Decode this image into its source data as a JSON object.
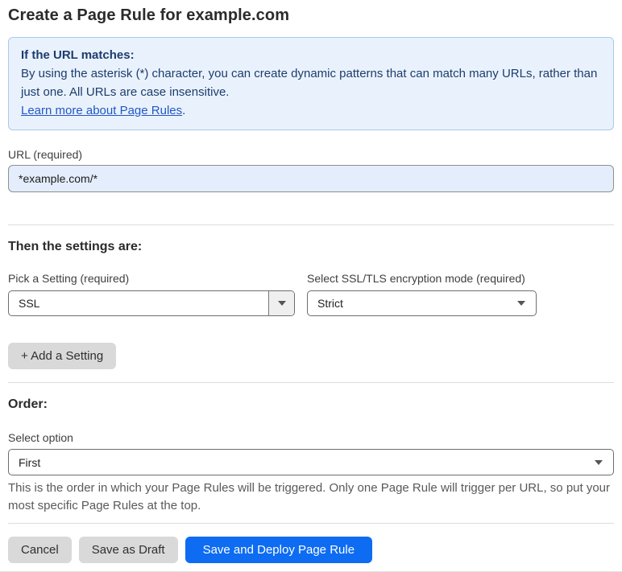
{
  "page": {
    "title": "Create a Page Rule for example.com"
  },
  "notice": {
    "heading": "If the URL matches:",
    "body": "By using the asterisk (*) character, you can create dynamic patterns that can match many URLs, rather than just one. All URLs are case insensitive.",
    "link": "Learn more about Page Rules",
    "link_suffix": "."
  },
  "url_field": {
    "label": "URL (required)",
    "value": "*example.com/*"
  },
  "settings": {
    "heading": "Then the settings are:",
    "setting_select": {
      "label": "Pick a Setting (required)",
      "value": "SSL"
    },
    "mode_select": {
      "label": "Select SSL/TLS encryption mode (required)",
      "value": "Strict"
    },
    "add_button": "+ Add a Setting"
  },
  "order": {
    "heading": "Order:",
    "select_label": "Select option",
    "value": "First",
    "help": "This is the order in which your Page Rules will be triggered. Only one Page Rule will trigger per URL, so put your most specific Page Rules at the top."
  },
  "footer": {
    "cancel": "Cancel",
    "save_draft": "Save as Draft",
    "save_deploy": "Save and Deploy Page Rule"
  },
  "colors": {
    "primary_blue": "#0d6cf2",
    "notice_bg": "#e9f2fc",
    "notice_border": "#abc9e9",
    "notice_text": "#1d3c6e",
    "link_blue": "#2257c5",
    "input_bg": "#e3edfb",
    "button_gray": "#d9d9d9",
    "divider_gray": "#dcdcdc"
  }
}
